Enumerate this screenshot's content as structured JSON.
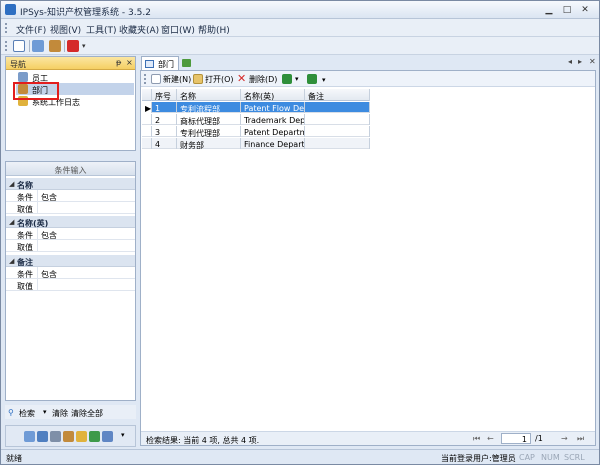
{
  "window": {
    "title": "IPSys-知识产权管理系统 - 3.5.2"
  },
  "menu": {
    "items": [
      {
        "label": "文件(F)"
      },
      {
        "label": "视图(V)"
      },
      {
        "label": "工具(T)"
      },
      {
        "label": "收藏夹(A)"
      },
      {
        "label": "窗口(W)"
      },
      {
        "label": "帮助(H)"
      }
    ]
  },
  "nav": {
    "title": "导航",
    "pin": "ᵽ",
    "close": "×",
    "items": [
      {
        "label": "员工"
      },
      {
        "label": "部门"
      },
      {
        "label": "系统工作日志"
      }
    ]
  },
  "criteria": {
    "title": "条件输入",
    "groups": [
      {
        "name": "名称",
        "cond_key": "条件",
        "cond_val": "包含",
        "val_key": "取值",
        "val_val": ""
      },
      {
        "name": "名称(英)",
        "cond_key": "条件",
        "cond_val": "包含",
        "val_key": "取值",
        "val_val": ""
      },
      {
        "name": "备注",
        "cond_key": "条件",
        "cond_val": "包含",
        "val_key": "取值",
        "val_val": ""
      }
    ]
  },
  "searchbar": {
    "search": "检索",
    "clear": "清除",
    "clear_all": "清除全部"
  },
  "tabs": {
    "active_label": "部门"
  },
  "content_toolbar": {
    "new_label": "新建(N)",
    "open_label": "打开(O)",
    "delete_label": "删除(D)"
  },
  "grid": {
    "columns": [
      "序号",
      "名称",
      "名称(英)",
      "备注"
    ],
    "rows": [
      [
        "1",
        "专利流程部",
        "Patent Flow Dep",
        ""
      ],
      [
        "2",
        "商标代理部",
        "Trademark Depa",
        ""
      ],
      [
        "3",
        "专利代理部",
        "Patent Departme",
        ""
      ],
      [
        "4",
        "财务部",
        "Finance Departm",
        ""
      ]
    ]
  },
  "result": {
    "text": "检索结果: 当前 4 项, 总共 4 项.",
    "page": "1",
    "total": "/1"
  },
  "statusbar": {
    "left": "就绪",
    "user": "当前登录用户:管理员",
    "cap": "CAP",
    "num": "NUM",
    "scrl": "SCRL"
  },
  "colors": {
    "accent": "#3d8be0",
    "nav_header": "#f5cf63",
    "highlight_box": "#e21d1d"
  }
}
